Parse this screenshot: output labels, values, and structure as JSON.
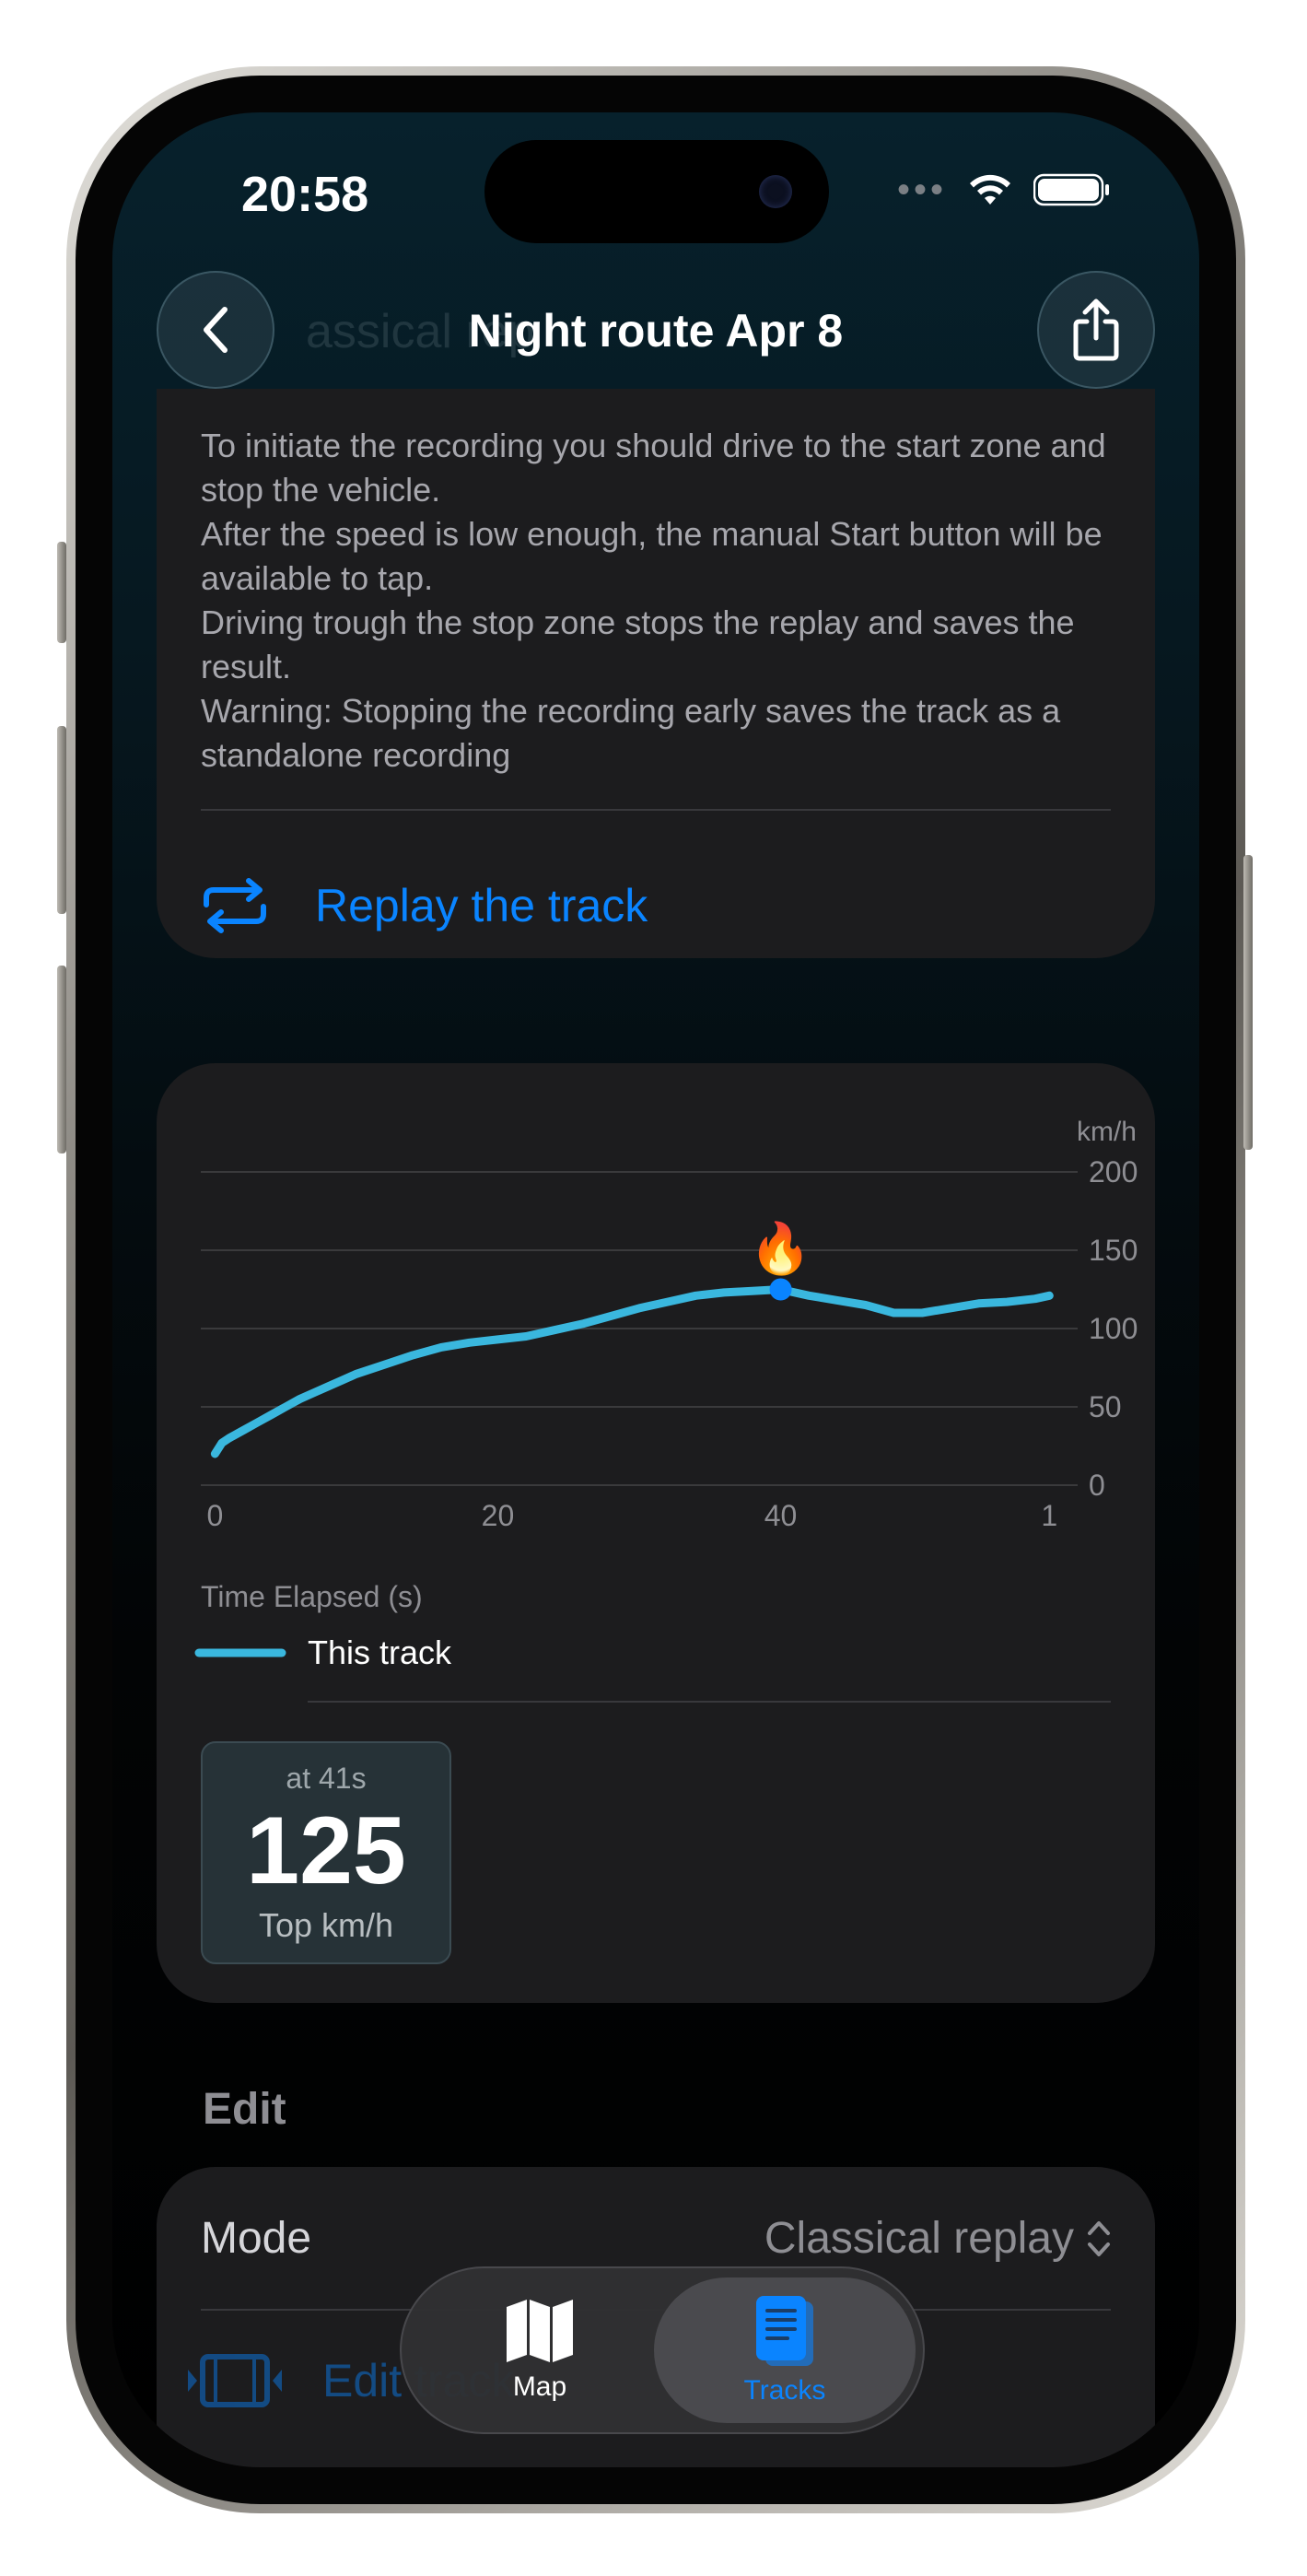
{
  "status_bar": {
    "time": "20:58",
    "extra": "•••"
  },
  "nav": {
    "title": "Night route Apr 8",
    "ghost_title": "assical rep"
  },
  "info": {
    "lines": [
      "To initiate the recording you should drive to the start zone and stop the vehicle.",
      "After the speed is low enough, the manual Start button will be available to tap.",
      "Driving trough the stop zone stops the replay and saves the result.",
      "Warning: Stopping the recording early saves the track as a standalone recording"
    ],
    "replay_label": "Replay the track"
  },
  "chart_data": {
    "type": "line",
    "title": "",
    "xlabel": "Time Elapsed (s)",
    "ylabel": "km/h",
    "y_unit": "km/h",
    "x_tick_labels": [
      "0",
      "20",
      "40",
      "1"
    ],
    "x_ticks": [
      0,
      20,
      40,
      59
    ],
    "xlim": [
      -1,
      61
    ],
    "ylim": [
      0,
      200
    ],
    "y_ticks": [
      0,
      50,
      100,
      150,
      200
    ],
    "grid": true,
    "legend": "bottom-left",
    "series": [
      {
        "name": "This track",
        "color": "#3ab7de",
        "x": [
          0,
          0.5,
          1,
          2,
          3,
          4,
          5,
          6,
          7,
          8,
          9,
          10,
          12,
          14,
          16,
          18,
          20,
          22,
          24,
          26,
          28,
          30,
          32,
          34,
          36,
          38,
          40,
          42,
          44,
          46,
          48,
          50,
          52,
          54,
          56,
          58,
          59
        ],
        "y": [
          20,
          27,
          30,
          35,
          40,
          45,
          50,
          55,
          59,
          63,
          67,
          71,
          77,
          83,
          88,
          91,
          93,
          95,
          99,
          103,
          108,
          113,
          117,
          121,
          123,
          124,
          125,
          121,
          118,
          115,
          110,
          110,
          113,
          116,
          117,
          119,
          121
        ]
      }
    ],
    "highlight": {
      "x": 40,
      "y": 125,
      "marker": "🔥",
      "color": "#0a84ff"
    }
  },
  "stats": {
    "at": "at 41s",
    "value": "125",
    "unit": "Top km/h"
  },
  "edit": {
    "section_title": "Edit",
    "mode_label": "Mode",
    "mode_value": "Classical replay",
    "edit_track_label": "Edit track"
  },
  "tabbar": {
    "items": [
      {
        "label": "Map",
        "icon": "map-icon",
        "selected": false
      },
      {
        "label": "Tracks",
        "icon": "book-icon",
        "selected": true
      }
    ]
  },
  "colors": {
    "accent": "#0a84ff",
    "line": "#3ab7de",
    "card": "#1c1c1e"
  }
}
